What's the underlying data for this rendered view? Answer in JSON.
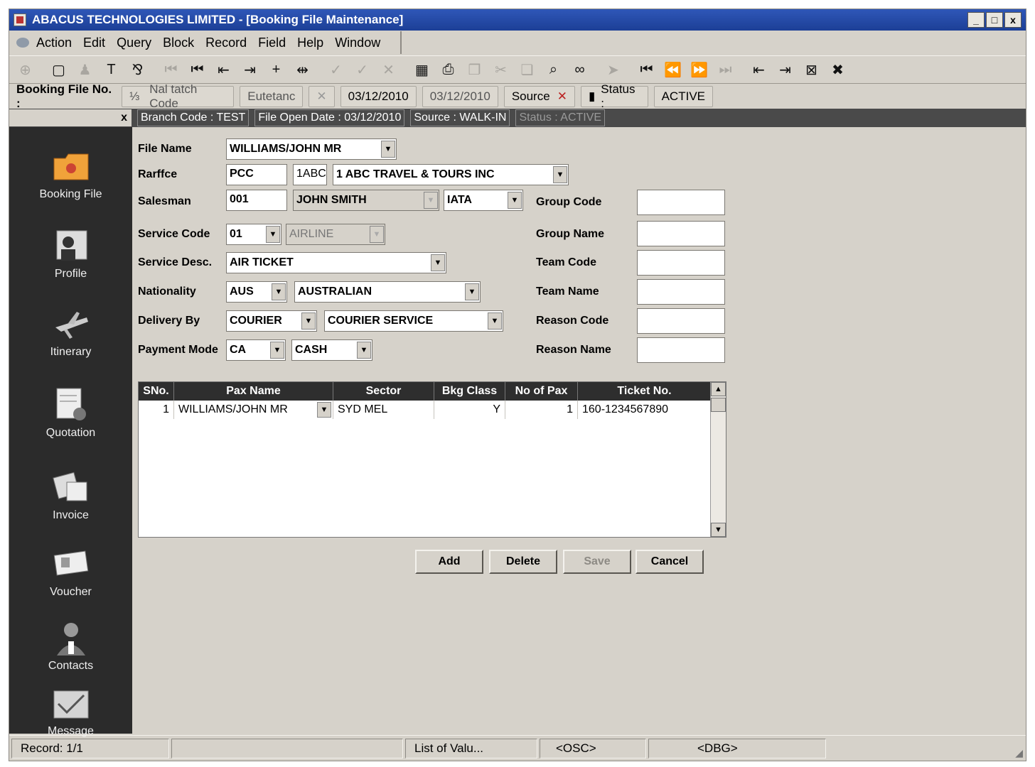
{
  "window": {
    "title": "ABACUS TECHNOLOGIES LIMITED - [Booking File Maintenance]",
    "controls": {
      "minimize": "_",
      "maximize": "□",
      "close": "x"
    }
  },
  "menu": [
    "Action",
    "Edit",
    "Query",
    "Block",
    "Record",
    "Field",
    "Help",
    "Window"
  ],
  "toolbar_icons": [
    {
      "name": "globe-icon",
      "glyph": "⊕",
      "enabled": false
    },
    {
      "name": "new-doc-icon",
      "glyph": "▢",
      "enabled": true
    },
    {
      "name": "bell-icon",
      "glyph": "♟",
      "enabled": false
    },
    {
      "name": "tool-icon",
      "glyph": "T",
      "enabled": true
    },
    {
      "name": "tree-icon",
      "glyph": "⅋",
      "enabled": true
    },
    {
      "name": "first-disabled-icon",
      "glyph": "⏮",
      "enabled": false
    },
    {
      "name": "first-record-icon",
      "glyph": "⏮",
      "enabled": true
    },
    {
      "name": "prev-block-icon",
      "glyph": "⇤",
      "enabled": true
    },
    {
      "name": "next-block-icon",
      "glyph": "⇥",
      "enabled": true
    },
    {
      "name": "insert-record-icon",
      "glyph": "+",
      "enabled": true
    },
    {
      "name": "duplicate-record-icon",
      "glyph": "⇹",
      "enabled": true
    },
    {
      "name": "check-disabled-icon",
      "glyph": "✓",
      "enabled": false
    },
    {
      "name": "check-icon",
      "glyph": "✓",
      "enabled": false
    },
    {
      "name": "delete-icon",
      "glyph": "✕",
      "enabled": false
    },
    {
      "name": "calculator-icon",
      "glyph": "▦",
      "enabled": true
    },
    {
      "name": "print-icon",
      "glyph": "⎙",
      "enabled": true
    },
    {
      "name": "copy-icon",
      "glyph": "❐",
      "enabled": false
    },
    {
      "name": "cut-icon",
      "glyph": "✂",
      "enabled": false
    },
    {
      "name": "paste-icon",
      "glyph": "❏",
      "enabled": false
    },
    {
      "name": "search-icon",
      "glyph": "⌕",
      "enabled": true
    },
    {
      "name": "glasses-icon",
      "glyph": "∞",
      "enabled": true
    },
    {
      "name": "arrow-icon",
      "glyph": "➤",
      "enabled": false
    },
    {
      "name": "first-nav-icon",
      "glyph": "⏮",
      "enabled": true
    },
    {
      "name": "rewind-icon",
      "glyph": "⏪",
      "enabled": true
    },
    {
      "name": "forward-icon",
      "glyph": "⏩",
      "enabled": false
    },
    {
      "name": "last-nav-icon",
      "glyph": "⏭",
      "enabled": false
    },
    {
      "name": "scroll-up-icon",
      "glyph": "⇤",
      "enabled": true
    },
    {
      "name": "scroll-down-icon",
      "glyph": "⇥",
      "enabled": true
    },
    {
      "name": "exit-icon",
      "glyph": "⊠",
      "enabled": true
    },
    {
      "name": "close-form-icon",
      "glyph": "✖",
      "enabled": true
    }
  ],
  "booking_bar": {
    "label": "Booking File No. :",
    "branch_code_ghost": "Nal tatch Code",
    "ghost2": "Eutetanc",
    "date1": "03/12/2010",
    "date2": "03/12/2010",
    "source_ghost": "Source",
    "status_label": "Status :",
    "status_value": "ACTIVE"
  },
  "info_bar": {
    "close": "x",
    "branch": "Branch Code : TEST",
    "open_date": "File Open Date : 03/12/2010",
    "source": "Source : WALK-IN",
    "status": "Status : ACTIVE"
  },
  "sidebar": [
    {
      "label": "Booking File",
      "icon": "folder-icon"
    },
    {
      "label": "Profile",
      "icon": "profile-icon"
    },
    {
      "label": "Itinerary",
      "icon": "airplane-icon"
    },
    {
      "label": "Quotation",
      "icon": "quotation-icon"
    },
    {
      "label": "Invoice",
      "icon": "invoice-icon"
    },
    {
      "label": "Voucher",
      "icon": "voucher-icon"
    },
    {
      "label": "Contacts",
      "icon": "contacts-icon"
    },
    {
      "label": "Message",
      "icon": "message-icon"
    }
  ],
  "form": {
    "file_name": {
      "label": "File Name",
      "value": "WILLIAMS/JOHN MR"
    },
    "rarffice": {
      "label": "Rarffce",
      "pcc": "PCC",
      "code": "1ABC",
      "agency": "1 ABC TRAVEL & TOURS INC"
    },
    "salesman": {
      "label": "Salesman",
      "code": "001",
      "name": "JOHN SMITH",
      "type": "IATA"
    },
    "service_code": {
      "label": "Service Code",
      "code": "01",
      "desc": "AIRLINE"
    },
    "service_desc": {
      "label": "Service Desc.",
      "value": "AIR TICKET"
    },
    "nationality": {
      "label": "Nationality",
      "code": "AUS",
      "name": "AUSTRALIAN"
    },
    "delivery_by": {
      "label": "Delivery By",
      "code": "COURIER",
      "name": "COURIER SERVICE"
    },
    "payment_mode": {
      "label": "Payment Mode",
      "code": "CA",
      "name": "CASH"
    },
    "right": {
      "group_code": "Group Code",
      "group_name": "Group Name",
      "team_code": "Team Code",
      "team_name": "Team Name",
      "reason_code": "Reason Code",
      "reason_name": "Reason Name"
    }
  },
  "grid": {
    "columns": [
      "SNo.",
      "Pax Name",
      "Sector",
      "Bkg Class",
      "No of Pax",
      "Ticket No."
    ],
    "rows": [
      {
        "sno": "1",
        "pax": "WILLIAMS/JOHN MR",
        "sector": "SYD MEL",
        "class": "Y",
        "count": "1",
        "ticket": "160-1234567890"
      }
    ]
  },
  "buttons": {
    "add": "Add",
    "delete": "Delete",
    "save": "Save",
    "cancel": "Cancel"
  },
  "statusbar": {
    "record": "Record: 1/1",
    "empty": "",
    "lov": "List of Valu...",
    "osc": "<OSC>",
    "dbg": "<DBG>"
  }
}
